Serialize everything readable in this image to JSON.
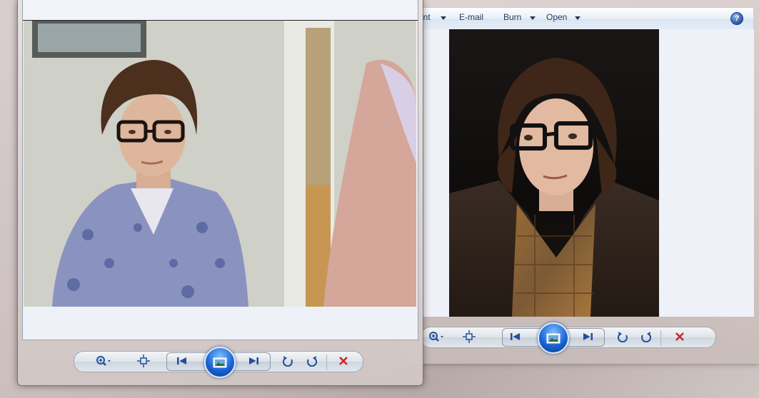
{
  "right_window": {
    "toolbar": {
      "print_label": "int",
      "email_label": "E-mail",
      "burn_label": "Burn",
      "open_label": "Open",
      "help_glyph": "?"
    },
    "icons": [
      "help-icon",
      "zoom-icon",
      "actual-size-icon",
      "previous-icon",
      "slideshow-icon",
      "next-icon",
      "rotate-counterclockwise-icon",
      "rotate-clockwise-icon",
      "delete-icon"
    ]
  },
  "left_window": {
    "icons": [
      "zoom-icon",
      "actual-size-icon",
      "previous-icon",
      "slideshow-icon",
      "next-icon",
      "rotate-counterclockwise-icon",
      "rotate-clockwise-icon",
      "delete-icon"
    ]
  },
  "colors": {
    "toolbar_text": "#1e395b",
    "slideshow_blue": "#1a64d6",
    "delete_red": "#c8262a",
    "nav_icon_blue": "#1f4f9c"
  }
}
